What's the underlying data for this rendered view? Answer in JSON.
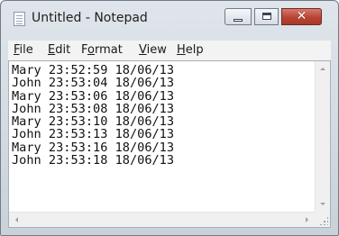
{
  "window": {
    "title": "Untitled - Notepad",
    "close_glyph": "✕"
  },
  "menu": {
    "file": {
      "key": "F",
      "rest": "ile"
    },
    "edit": {
      "key": "E",
      "rest": "dit"
    },
    "format": {
      "pre": "F",
      "key": "o",
      "rest": "rmat"
    },
    "view": {
      "key": "V",
      "rest": "iew"
    },
    "help": {
      "key": "H",
      "rest": "elp"
    }
  },
  "editor": {
    "lines": [
      "Mary 23:52:59 18/06/13",
      "John 23:53:04 18/06/13",
      "Mary 23:53:06 18/06/13",
      "John 23:53:08 18/06/13",
      "Mary 23:53:10 18/06/13",
      "John 23:53:13 18/06/13",
      "Mary 23:53:16 18/06/13",
      "John 23:53:18 18/06/13"
    ]
  },
  "colors": {
    "close_button": "#b94433",
    "frame": "#c9d1d9"
  },
  "icons": {
    "app": "notepad-icon",
    "minimize": "minimize-icon",
    "maximize": "maximize-icon",
    "close": "close-icon"
  }
}
